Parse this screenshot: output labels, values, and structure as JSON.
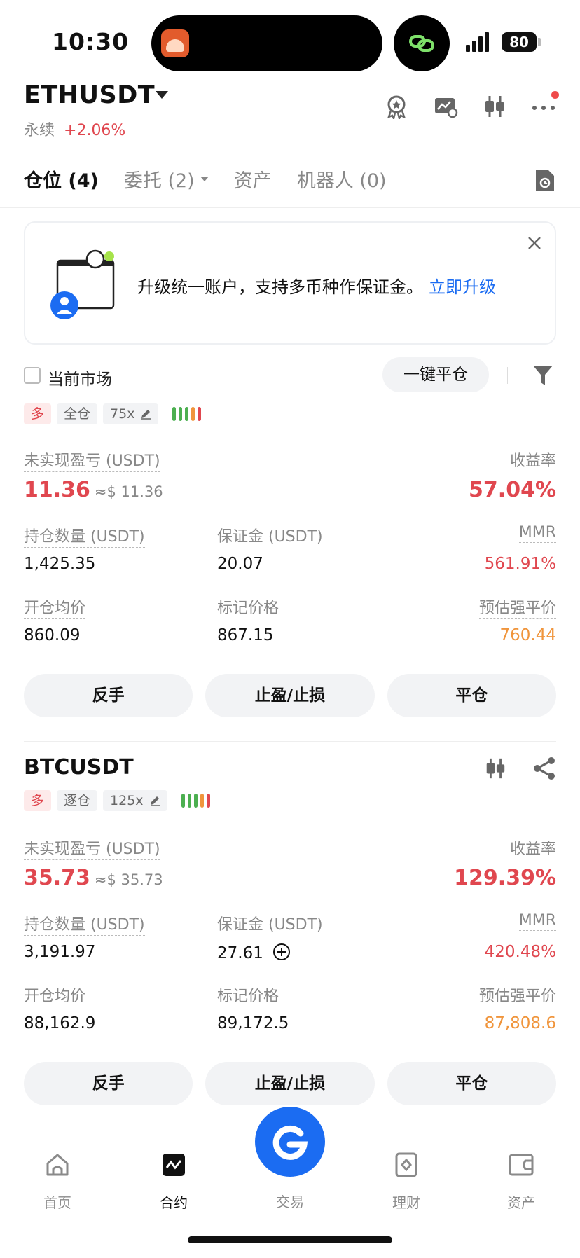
{
  "status_bar": {
    "time": "10:30",
    "battery": "80"
  },
  "header": {
    "pair": "ETHUSDT",
    "contract_type": "永续",
    "change": "+2.06%"
  },
  "tabs": [
    {
      "label": "仓位 (4)",
      "active": true
    },
    {
      "label": "委托 (2)",
      "active": false
    },
    {
      "label": "资产",
      "active": false
    },
    {
      "label": "机器人 (0)",
      "active": false
    }
  ],
  "banner": {
    "text": "升级统一账户，支持多币种作保证金。",
    "link": "立即升级"
  },
  "filter": {
    "current_market": "当前市场",
    "close_all": "一键平仓"
  },
  "positions": [
    {
      "side": "多",
      "margin_mode": "全仓",
      "leverage": "75x",
      "pnl_label": "未实现盈亏 (USDT)",
      "pnl": "11.36",
      "pnl_usd": "≈$ 11.36",
      "roe_label": "收益率",
      "roe": "57.04%",
      "size_label": "持仓数量 (USDT)",
      "size": "1,425.35",
      "margin_label": "保证金 (USDT)",
      "margin": "20.07",
      "mmr_label": "MMR",
      "mmr": "561.91%",
      "entry_label": "开仓均价",
      "entry": "860.09",
      "mark_label": "标记价格",
      "mark": "867.15",
      "liq_label": "预估强平价",
      "liq": "760.44",
      "actions": [
        "反手",
        "止盈/止损",
        "平仓"
      ]
    },
    {
      "symbol": "BTCUSDT",
      "side": "多",
      "margin_mode": "逐仓",
      "leverage": "125x",
      "pnl_label": "未实现盈亏 (USDT)",
      "pnl": "35.73",
      "pnl_usd": "≈$ 35.73",
      "roe_label": "收益率",
      "roe": "129.39%",
      "size_label": "持仓数量 (USDT)",
      "size": "3,191.97",
      "margin_label": "保证金 (USDT)",
      "margin": "27.61",
      "mmr_label": "MMR",
      "mmr": "420.48%",
      "entry_label": "开仓均价",
      "entry": "88,162.9",
      "mark_label": "标记价格",
      "mark": "89,172.5",
      "liq_label": "预估强平价",
      "liq": "87,808.6",
      "actions": [
        "反手",
        "止盈/止损",
        "平仓"
      ]
    }
  ],
  "bottom_nav": [
    {
      "label": "首页",
      "icon": "home-icon"
    },
    {
      "label": "合约",
      "icon": "futures-icon",
      "active": true
    },
    {
      "label": "交易",
      "icon": "trade-icon"
    },
    {
      "label": "理财",
      "icon": "earn-icon"
    },
    {
      "label": "资产",
      "icon": "wallet-icon"
    }
  ],
  "colors": {
    "red": "#e0474f",
    "orange": "#f0953c",
    "blue": "#1b6cf2",
    "green": "#4caf50"
  }
}
